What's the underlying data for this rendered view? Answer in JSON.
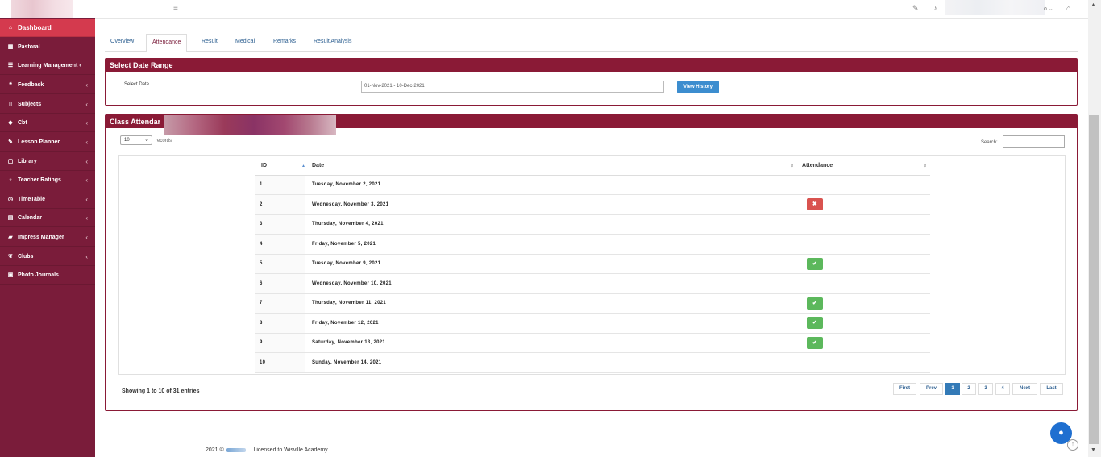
{
  "sidebar": {
    "items": [
      {
        "label": "Dashboard",
        "icon": "home-icon",
        "glyph": "⌂",
        "has_children": false,
        "active": true
      },
      {
        "label": "Pastoral",
        "icon": "grid-icon",
        "glyph": "▦",
        "has_children": false
      },
      {
        "label": "Learning Management ‹",
        "icon": "list-icon",
        "glyph": "☰",
        "has_children": false
      },
      {
        "label": "Feedback",
        "icon": "comments-icon",
        "glyph": "❝",
        "has_children": true
      },
      {
        "label": "Subjects",
        "icon": "book-icon",
        "glyph": "▯",
        "has_children": true
      },
      {
        "label": "Cbt",
        "icon": "graduation-cap-icon",
        "glyph": "◆",
        "has_children": true
      },
      {
        "label": "Lesson Planner",
        "icon": "edit-icon",
        "glyph": "✎",
        "has_children": true
      },
      {
        "label": "Library",
        "icon": "edit-square-icon",
        "glyph": "▢",
        "has_children": true
      },
      {
        "label": "Teacher Ratings",
        "icon": "trophy-icon",
        "glyph": "♆",
        "has_children": true
      },
      {
        "label": "TimeTable",
        "icon": "clock-icon",
        "glyph": "◷",
        "has_children": true
      },
      {
        "label": "Calendar",
        "icon": "calendar-icon",
        "glyph": "▤",
        "has_children": true
      },
      {
        "label": "Impress Manager",
        "icon": "truck-icon",
        "glyph": "▰",
        "has_children": true
      },
      {
        "label": "Clubs",
        "icon": "leaf-icon",
        "glyph": "❦",
        "has_children": true
      },
      {
        "label": "Photo Journals",
        "icon": "film-icon",
        "glyph": "▣",
        "has_children": false
      }
    ],
    "chevron": "‹"
  },
  "topbar": {
    "hamburger": "≡",
    "edit_glyph": "✎",
    "bell_glyph": "♪",
    "user_caret": "o ⌄",
    "home_glyph": "⌂"
  },
  "tabs": [
    "Overview",
    "Attendance",
    "Result",
    "Medical",
    "Remarks",
    "Result Analysis"
  ],
  "date_range": {
    "title": "Select Date Range",
    "label": "Select Date",
    "value": "01-Nov-2021 - 10-Dec-2021",
    "button": "View History"
  },
  "attendance": {
    "title": "Class Attendar",
    "length_value": "10",
    "length_suffix": "records",
    "search_label": "Search:",
    "columns": [
      "ID",
      "Date",
      "Attendance"
    ],
    "rows": [
      {
        "id": "1",
        "date": "Tuesday, November 2, 2021",
        "status": ""
      },
      {
        "id": "2",
        "date": "Wednesday, November 3, 2021",
        "status": "absent"
      },
      {
        "id": "3",
        "date": "Thursday, November 4, 2021",
        "status": ""
      },
      {
        "id": "4",
        "date": "Friday, November 5, 2021",
        "status": ""
      },
      {
        "id": "5",
        "date": "Tuesday, November 9, 2021",
        "status": "present"
      },
      {
        "id": "6",
        "date": "Wednesday, November 10, 2021",
        "status": ""
      },
      {
        "id": "7",
        "date": "Thursday, November 11, 2021",
        "status": "present"
      },
      {
        "id": "8",
        "date": "Friday, November 12, 2021",
        "status": "present"
      },
      {
        "id": "9",
        "date": "Saturday, November 13, 2021",
        "status": "present"
      },
      {
        "id": "10",
        "date": "Sunday, November 14, 2021",
        "status": ""
      }
    ],
    "info": "Showing 1 to 10 of 31 entries",
    "pagination": [
      "First",
      "Prev",
      "1",
      "2",
      "3",
      "4",
      "Next",
      "Last"
    ],
    "current_page": "1"
  },
  "footer": {
    "year": "2021 ©",
    "license": "| Licensed to Wisville Academy"
  },
  "colors": {
    "sidebar": "#7a1c3a",
    "active": "#d43a4e",
    "panel": "#8a1a36",
    "present": "#5cb85c",
    "absent": "#d9534f",
    "link": "#2a5d8f"
  }
}
